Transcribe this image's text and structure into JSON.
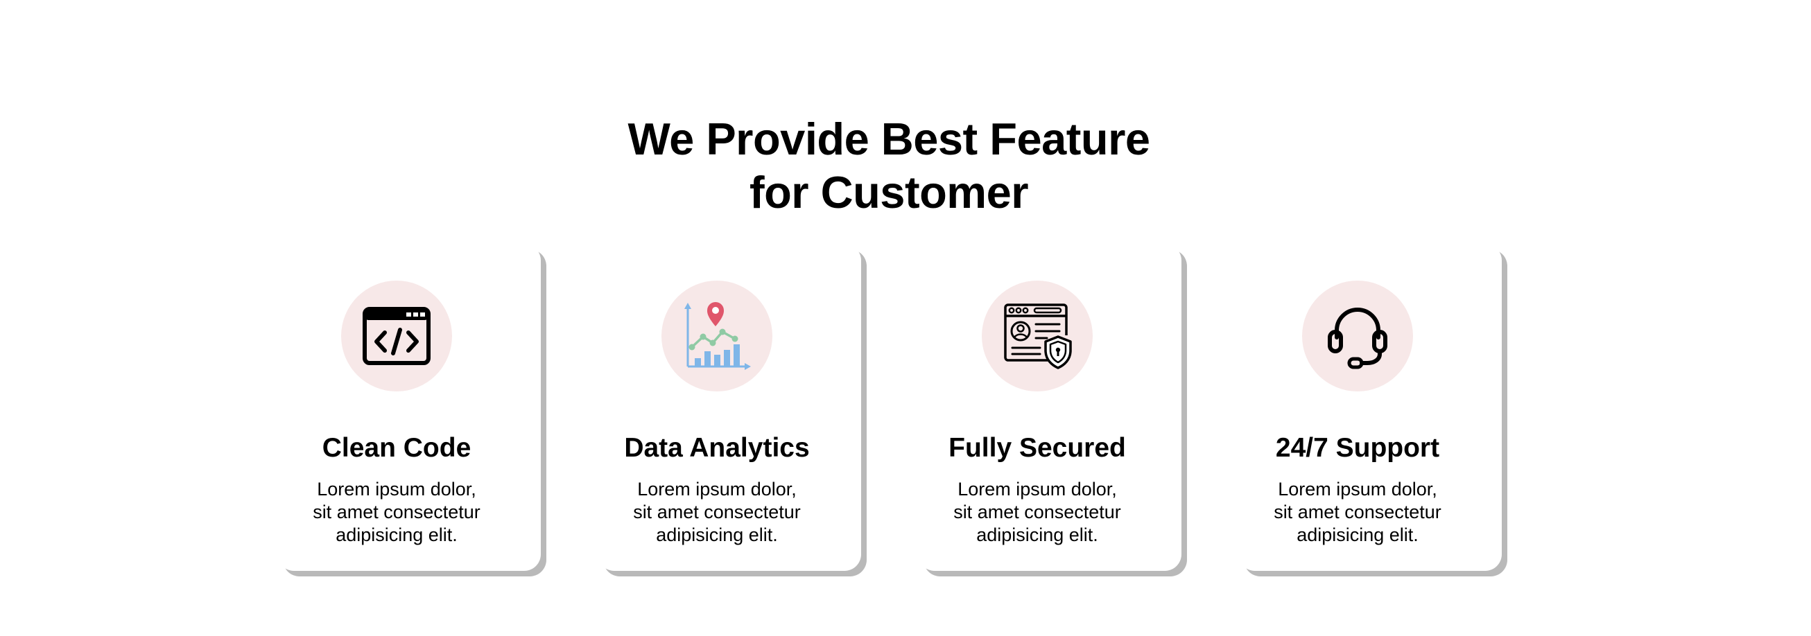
{
  "section": {
    "heading_line1": "We Provide Best Feature",
    "heading_line2": "for Customer"
  },
  "cards": [
    {
      "title": "Clean Code",
      "description": "Lorem ipsum dolor,\nsit amet consectetur\nadipisicing elit.",
      "icon": "code-window-icon"
    },
    {
      "title": "Data Analytics",
      "description": "Lorem ipsum dolor,\nsit amet consectetur\nadipisicing elit.",
      "icon": "analytics-chart-icon"
    },
    {
      "title": "Fully Secured",
      "description": "Lorem ipsum dolor,\nsit amet consectetur\nadipisicing elit.",
      "icon": "secure-profile-icon"
    },
    {
      "title": "24/7 Support",
      "description": "Lorem ipsum dolor,\nsit amet consectetur\nadipisicing elit.",
      "icon": "headset-icon"
    }
  ],
  "colors": {
    "icon_circle_bg": "#f7e8e8",
    "card_shadow": "#b9b9b9",
    "analytics_bar": "#7fb6e8",
    "analytics_line": "#8fcaa4",
    "analytics_pin": "#e0566b"
  }
}
